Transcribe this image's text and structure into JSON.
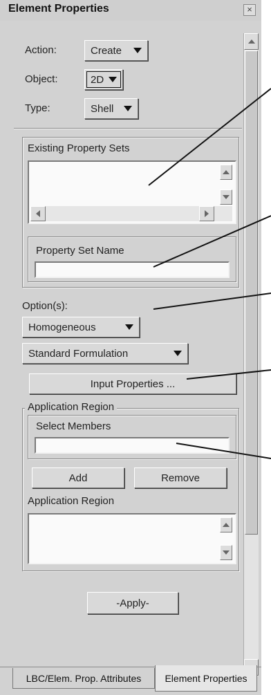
{
  "window": {
    "title": "Element Properties",
    "close_glyph": "×"
  },
  "form": {
    "action_label": "Action:",
    "action_value": "Create",
    "object_label": "Object:",
    "object_value": "2D",
    "type_label": "Type:",
    "type_value": "Shell"
  },
  "existing_sets": {
    "label": "Existing Property Sets"
  },
  "property_set_name": {
    "label": "Property Set Name",
    "value": ""
  },
  "options": {
    "label": "Option(s):",
    "option1": "Homogeneous",
    "option2": "Standard Formulation"
  },
  "input_properties_label": "Input Properties ...",
  "application_region": {
    "group_label": "Application Region",
    "select_members_label": "Select Members",
    "select_members_value": "",
    "add_label": "Add",
    "remove_label": "Remove",
    "list_label": "Application Region"
  },
  "apply_label": "-Apply-",
  "tabs": [
    {
      "label": "LBC/Elem. Prop. Attributes",
      "active": false
    },
    {
      "label": "Element Properties",
      "active": true
    }
  ]
}
